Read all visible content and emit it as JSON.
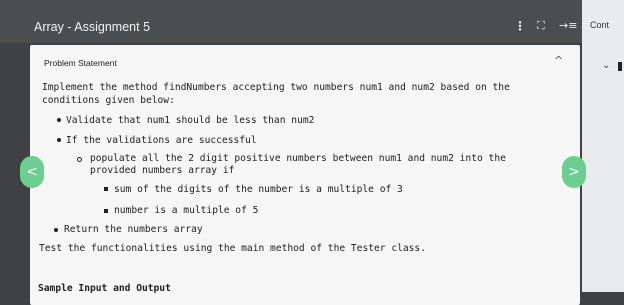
{
  "app": {
    "title": "Array - Assignment 5",
    "toolbar": {
      "kebab": "⋮",
      "expand": "⛶",
      "toggle": "→≡"
    }
  },
  "right_panel": {
    "cont_label": "Cont",
    "chevron": "⌄"
  },
  "problem": {
    "section_label": "Problem Statement",
    "collapse_chevron": "^",
    "intro": "Implement the method findNumbers accepting two numbers num1 and num2 based on the conditions given below:",
    "items": [
      "Validate that num1 should be less than num2",
      "If the validations are successful"
    ],
    "sub_item": "populate all the 2 digit positive numbers between num1 and num2 into the provided numbers array if",
    "conditions": [
      "sum of the digits of the number is a multiple of 3",
      "number is a multiple of 5"
    ],
    "return_item": "Return the numbers array",
    "test_line": "Test the functionalities using the main method of the Tester class.",
    "sample_heading": "Sample Input and Output"
  },
  "nav": {
    "prev": "<",
    "next": ">"
  },
  "colors": {
    "nav_accent": "#6ccf8f",
    "topbar": "#4b4e50",
    "card": "#f6f6f6"
  }
}
